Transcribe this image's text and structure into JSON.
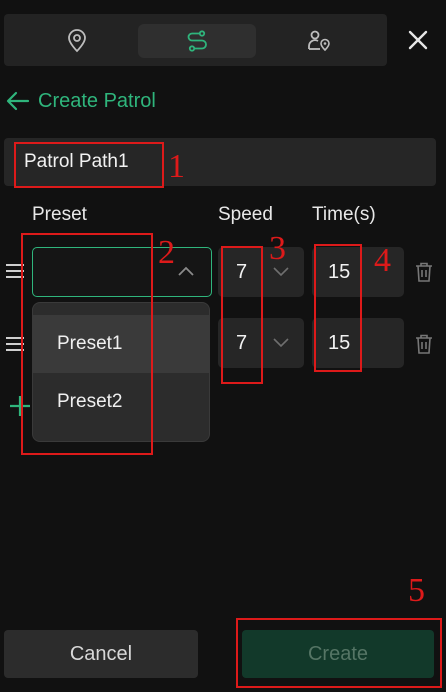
{
  "tabs": [
    {
      "icon": "location-pin-icon",
      "active": false
    },
    {
      "icon": "route-icon",
      "active": true
    },
    {
      "icon": "person-location-icon",
      "active": false
    }
  ],
  "header": {
    "back_label": "Create Patrol"
  },
  "form": {
    "name_value": "Patrol Path1",
    "columns": {
      "preset": "Preset",
      "speed": "Speed",
      "time": "Time(s)"
    },
    "rows": [
      {
        "preset": "",
        "speed": "7",
        "time": "15"
      },
      {
        "preset": "",
        "speed": "7",
        "time": "15"
      }
    ],
    "preset_options": [
      "Preset1",
      "Preset2"
    ]
  },
  "buttons": {
    "cancel": "Cancel",
    "create": "Create"
  },
  "annotations": [
    "1",
    "2",
    "3",
    "4",
    "5"
  ],
  "colors": {
    "accent": "#2fb57c",
    "background": "#111111",
    "annotation": "#dd1a1a",
    "create_bg": "#12392a"
  }
}
